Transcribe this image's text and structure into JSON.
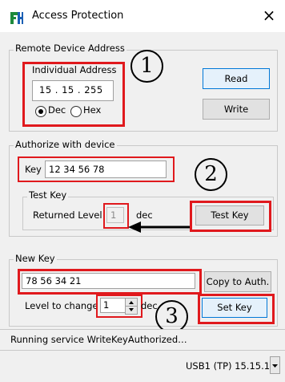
{
  "window": {
    "title": "Access Protection",
    "close_glyph": "×",
    "icon": "app-logo-icon"
  },
  "remote": {
    "group_label": "Remote Device Address",
    "individual_label": "Individual Address",
    "address": "15 . 15 . 255",
    "radio_dec": "Dec",
    "radio_hex": "Hex",
    "selected": "Dec",
    "read_label": "Read",
    "write_label": "Write"
  },
  "authorize": {
    "group_label": "Authorize with device",
    "key_label": "Key",
    "key_value": "12 34 56 78",
    "test_group_label": "Test Key",
    "returned_label": "Returned Level",
    "returned_value": "1",
    "dec_label": "dec",
    "test_button": "Test Key"
  },
  "new_key": {
    "group_label": "New Key",
    "key_value": "78 56 34 21",
    "copy_button": "Copy to Auth.",
    "level_label": "Level to change",
    "level_value": "1",
    "dec_label": "dec",
    "set_button": "Set Key"
  },
  "annotations": {
    "one": "1",
    "two": "2",
    "three": "3"
  },
  "status": {
    "message": "Running service WriteKeyAuthorized…",
    "connection": "USB1 (TP) 15.15.1"
  },
  "colors": {
    "highlight": "#e0191d",
    "default_button": "#0078d7"
  }
}
